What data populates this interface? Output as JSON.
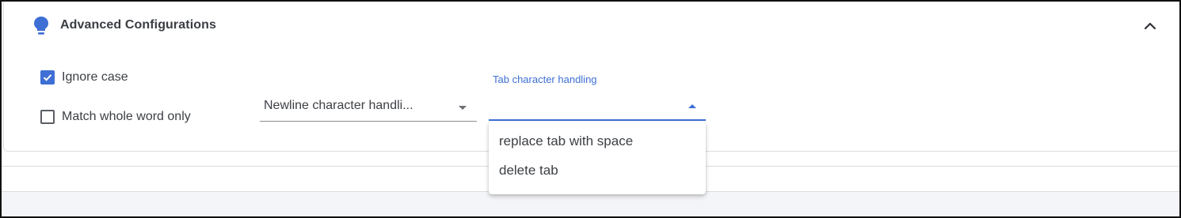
{
  "header": {
    "icon": "lightbulb-icon",
    "title": "Advanced Configurations",
    "collapse_icon": "chevron-up-icon"
  },
  "options": {
    "ignore_case": {
      "label": "Ignore case",
      "checked": true
    },
    "match_whole_word": {
      "label": "Match whole word only",
      "checked": false
    }
  },
  "newline_select": {
    "value": "Newline character handli..."
  },
  "tab_select": {
    "label": "Tab character handling",
    "value": "",
    "open": true,
    "options": [
      "replace tab with space",
      "delete tab"
    ]
  },
  "colors": {
    "accent": "#3e6fd4",
    "text": "#3c3f44"
  }
}
